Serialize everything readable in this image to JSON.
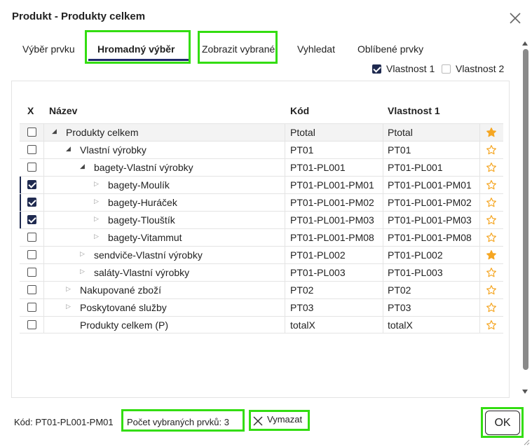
{
  "dialog": {
    "title": "Produkt - Produkty celkem"
  },
  "tabs": [
    {
      "label": "Výběr prvku",
      "active": false
    },
    {
      "label": "Hromadný výběr",
      "active": true
    },
    {
      "label": "Zobrazit vybrané",
      "active": false
    },
    {
      "label": "Vyhledat",
      "active": false
    },
    {
      "label": "Oblíbené prvky",
      "active": false
    }
  ],
  "properties": [
    {
      "label": "Vlastnost 1",
      "checked": true
    },
    {
      "label": "Vlastnost 2",
      "checked": false
    }
  ],
  "table": {
    "columns": [
      "X",
      "Název",
      "Kód",
      "Vlastnost 1"
    ],
    "rows": [
      {
        "checked": false,
        "expand": "expanded",
        "name": "Produkty celkem",
        "code": "Ptotal",
        "prop1": "Ptotal",
        "favorite": true
      },
      {
        "checked": false,
        "expand": "expanded",
        "name": "Vlastní výrobky",
        "code": "PT01",
        "prop1": "PT01",
        "favorite": false
      },
      {
        "checked": false,
        "expand": "expanded",
        "name": "bagety-Vlastní výrobky",
        "code": "PT01-PL001",
        "prop1": "PT01-PL001",
        "favorite": false
      },
      {
        "checked": true,
        "expand": "collapsed",
        "name": "bagety-Moulík",
        "code": "PT01-PL001-PM01",
        "prop1": "PT01-PL001-PM01",
        "favorite": false
      },
      {
        "checked": true,
        "expand": "collapsed",
        "name": "bagety-Huráček",
        "code": "PT01-PL001-PM02",
        "prop1": "PT01-PL001-PM02",
        "favorite": false
      },
      {
        "checked": true,
        "expand": "collapsed",
        "name": "bagety-Tlouštík",
        "code": "PT01-PL001-PM03",
        "prop1": "PT01-PL001-PM03",
        "favorite": false
      },
      {
        "checked": false,
        "expand": "collapsed",
        "name": "bagety-Vitammut",
        "code": "PT01-PL001-PM08",
        "prop1": "PT01-PL001-PM08",
        "favorite": false
      },
      {
        "checked": false,
        "expand": "collapsed",
        "name": "sendviče-Vlastní výrobky",
        "code": "PT01-PL002",
        "prop1": "PT01-PL002",
        "favorite": true
      },
      {
        "checked": false,
        "expand": "collapsed",
        "name": "saláty-Vlastní výrobky",
        "code": "PT01-PL003",
        "prop1": "PT01-PL003",
        "favorite": false
      },
      {
        "checked": false,
        "expand": "collapsed",
        "name": "Nakupované zboží",
        "code": "PT02",
        "prop1": "PT02",
        "favorite": false
      },
      {
        "checked": false,
        "expand": "collapsed",
        "name": "Poskytované služby",
        "code": "PT03",
        "prop1": "PT03",
        "favorite": false
      },
      {
        "checked": false,
        "expand": "none",
        "name": "Produkty celkem (P)",
        "code": "totalX",
        "prop1": "totalX",
        "favorite": false
      }
    ]
  },
  "footer": {
    "code_text": "Kód: PT01-PL001-PM01",
    "count_text": "Počet vybraných prvků: 3",
    "clear_label": "Vymazat",
    "ok_label": "OK"
  },
  "colors": {
    "highlight": "#33dd11",
    "accent": "#1f2a50",
    "star": "#f5a623"
  }
}
